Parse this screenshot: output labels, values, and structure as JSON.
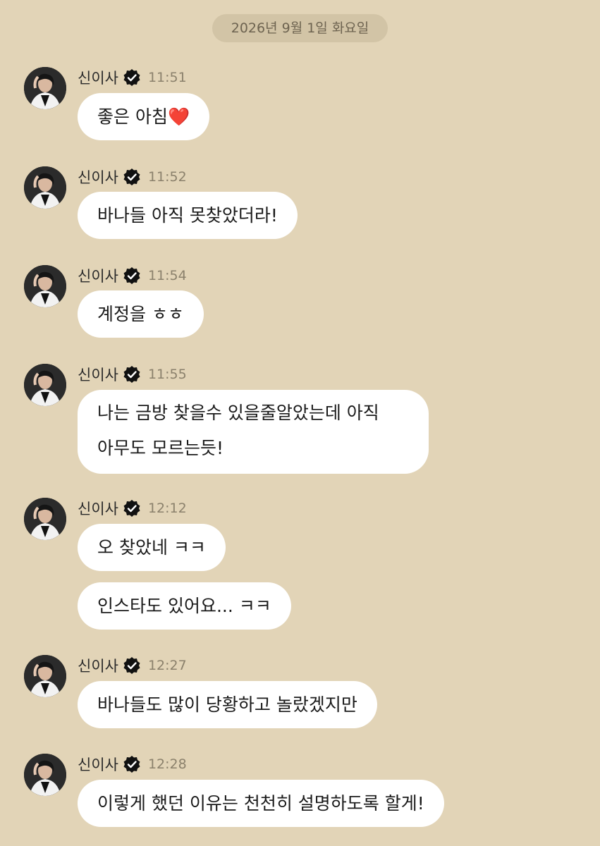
{
  "date_divider": "2026년 9월 1일 화요일",
  "sender": {
    "name": "신이사",
    "avatar_icon": "profile-photo",
    "badge_icon": "verified-badge-icon"
  },
  "messages": [
    {
      "time": "11:51",
      "bubbles": [
        {
          "text": "좋은 아침",
          "emoji": "❤️"
        }
      ]
    },
    {
      "time": "11:52",
      "bubbles": [
        {
          "text": "바나들 아직 못찾았더라!"
        }
      ]
    },
    {
      "time": "11:54",
      "bubbles": [
        {
          "text": "계정을 ㅎㅎ"
        }
      ]
    },
    {
      "time": "11:55",
      "bubbles": [
        {
          "lines": [
            "나는 금방 찾을수 있을줄알았는데 아직",
            "아무도 모르는듯!"
          ]
        }
      ]
    },
    {
      "time": "12:12",
      "bubbles": [
        {
          "text": "오 찾았네 ㅋㅋ"
        },
        {
          "text": "인스타도 있어요... ㅋㅋ"
        }
      ]
    },
    {
      "time": "12:27",
      "bubbles": [
        {
          "text": "바나들도 많이 당황하고 놀랐겠지만"
        }
      ]
    },
    {
      "time": "12:28",
      "bubbles": [
        {
          "text": "이렇게 했던 이유는 천천히 설명하도록 할게!"
        }
      ]
    }
  ],
  "colors": {
    "background": "#e2d4b7",
    "date_pill": "#d2c4a6",
    "bubble": "#ffffff",
    "time_text": "#8b816c"
  }
}
